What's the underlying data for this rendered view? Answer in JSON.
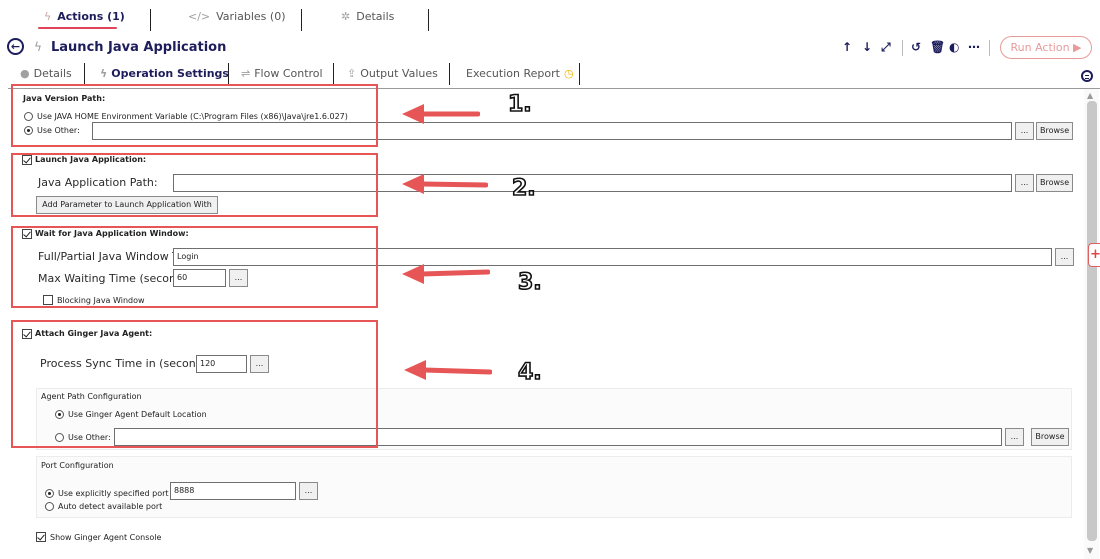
{
  "top_tabs": [
    {
      "label": "Actions (1)",
      "icon": "bolt-icon"
    },
    {
      "label": "Variables (0)",
      "icon": "code-icon"
    },
    {
      "label": "Details",
      "icon": "gear-icon"
    }
  ],
  "header": {
    "title": "Launch Java Application",
    "run_action": "Run Action ▶"
  },
  "sub_tabs": [
    {
      "label": "Details",
      "icon": "info-icon"
    },
    {
      "label": "Operation Settings",
      "icon": "bolt-icon"
    },
    {
      "label": "Flow Control",
      "icon": "signpost-icon"
    },
    {
      "label": "Output Values",
      "icon": "upload-icon"
    },
    {
      "label": "Execution Report",
      "icon": "clock-icon"
    }
  ],
  "java_version": {
    "heading": "Java Version Path:",
    "option_home": "Use JAVA HOME Environment Variable (C:\\Program Files (x86)\\Java\\jre1.6.027)",
    "option_other": "Use Other:",
    "other_value": ""
  },
  "launch": {
    "heading": "Launch Java Application:",
    "path_label": "Java Application Path:",
    "path_value": "",
    "add_param": "Add Parameter to Launch Application With"
  },
  "wait": {
    "heading": "Wait for Java Application Window:",
    "title_label": "Full/Partial Java Window Titl",
    "title_value": "Login",
    "max_label": "Max Waiting Time (seconds):",
    "max_value": "60",
    "blocking": "Blocking Java Window"
  },
  "agent": {
    "heading": "Attach Ginger Java Agent:",
    "sync_label": "Process Sync Time in (seconds):",
    "sync_value": "120",
    "path_config": "Agent Path Configuration",
    "default_location": "Use Ginger Agent Default Location",
    "use_other": "Use Other:",
    "other_value": ""
  },
  "port": {
    "heading": "Port Configuration",
    "explicit": "Use explicitly specified port",
    "port_value": "8888",
    "auto": "Auto detect available port"
  },
  "console": {
    "label": "Show Ginger Agent Console"
  },
  "buttons": {
    "ellipsis": "...",
    "browse": "Browse"
  },
  "annotations": {
    "n1": "1.",
    "n2": "2.",
    "n3": "3.",
    "n4": "4."
  },
  "colors": {
    "accent": "#e0455b",
    "navy": "#1d1d5c",
    "annotation_red": "#e75656"
  }
}
